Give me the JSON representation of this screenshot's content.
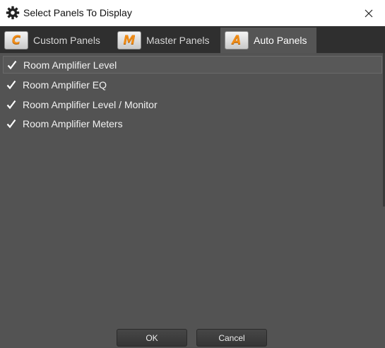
{
  "window": {
    "title": "Select Panels To Display",
    "icon": "gear-icon",
    "close_icon": "close-icon"
  },
  "tabs": [
    {
      "badge": "C",
      "label": "Custom Panels",
      "active": false
    },
    {
      "badge": "M",
      "label": "Master Panels",
      "active": false
    },
    {
      "badge": "A",
      "label": "Auto Panels",
      "active": true
    }
  ],
  "panels": [
    {
      "label": "Room Amplifier Level",
      "checked": true,
      "selected": true
    },
    {
      "label": "Room Amplifier EQ",
      "checked": true,
      "selected": false
    },
    {
      "label": "Room Amplifier Level / Monitor",
      "checked": true,
      "selected": false
    },
    {
      "label": "Room Amplifier Meters",
      "checked": true,
      "selected": false
    }
  ],
  "buttons": {
    "ok": "OK",
    "cancel": "Cancel"
  },
  "colors": {
    "badge_accent": "#f08c17",
    "panel_bg": "#535353",
    "tabstrip_bg": "#2f2f2f"
  }
}
